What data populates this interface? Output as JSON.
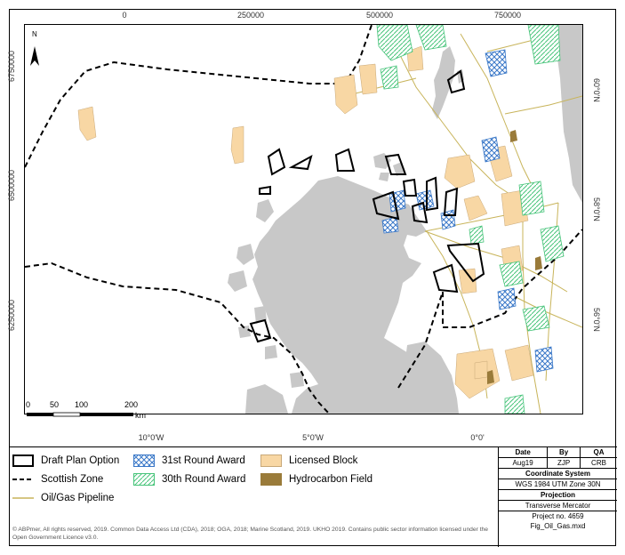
{
  "map": {
    "top_ticks": [
      "0",
      "250000",
      "500000",
      "750000"
    ],
    "bottom_ticks": [
      "10°0'W",
      "5°0'W",
      "0°0'"
    ],
    "left_ticks": [
      "6750000",
      "6500000",
      "6250000"
    ],
    "right_ticks": [
      "60°0'N",
      "58°0'N",
      "56°0'N"
    ],
    "north_label": "N",
    "scale_labels": [
      "0",
      "50",
      "100",
      "200"
    ],
    "scale_unit": "km"
  },
  "legend": {
    "draft_plan": "Draft Plan Option",
    "scottish_zone": "Scottish Zone",
    "pipeline": "Oil/Gas Pipeline",
    "round31": "31st Round Award",
    "round30": "30th Round Award",
    "licensed": "Licensed Block",
    "hydrocarbon": "Hydrocarbon Field",
    "colors": {
      "licensed": "#f8d7a4",
      "hydrocarbon": "#9a7b3a",
      "round31": "#3a78c8",
      "round30": "#47c47a",
      "pipeline": "#c8b45a",
      "land": "#c8c8c8"
    }
  },
  "copyright": "© ABPmer, All rights reserved, 2019. Common Data Access Ltd (CDA), 2018; OGA, 2018; Marine Scotland, 2019. UKHO 2019. Contains public sector information licensed under the Open Government Licence v3.0.",
  "info": {
    "date_h": "Date",
    "by_h": "By",
    "qa_h": "QA",
    "date": "Aug19",
    "by": "ZJP",
    "qa": "CRB",
    "coord_h": "Coordinate System",
    "coord": "WGS 1984 UTM Zone 30N",
    "proj_h": "Projection",
    "proj": "Transverse Mercator",
    "project": "Project no. 4659",
    "file": "Fig_Oil_Gas.mxd"
  }
}
